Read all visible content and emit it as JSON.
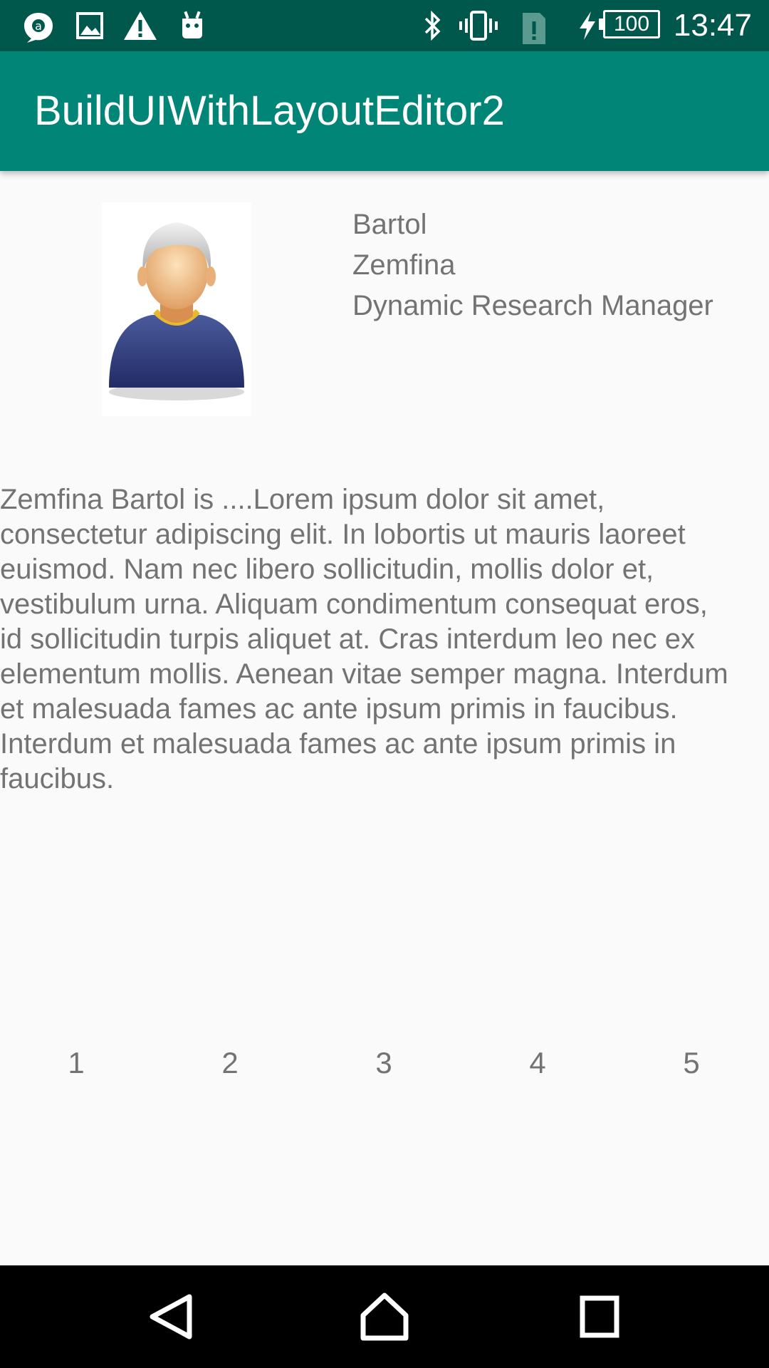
{
  "status_bar": {
    "left_icons": [
      "copilot-icon",
      "image-icon",
      "warning-icon",
      "android-icon"
    ],
    "right_icons": [
      "bluetooth-icon",
      "vibrate-icon",
      "sim-alert-icon",
      "charging-icon"
    ],
    "battery_level": "100",
    "time": "13:47"
  },
  "app_bar": {
    "title": "BuildUIWithLayoutEditor2"
  },
  "profile": {
    "last_name": "Bartol",
    "first_name": "Zemfina",
    "job_title": "Dynamic Research Manager",
    "avatar_icon": "person-avatar-icon"
  },
  "bio": {
    "text": "Zemfina Bartol is ....Lorem ipsum dolor sit amet,\nconsectetur adipiscing elit. In lobortis ut mauris laoreet\neuismod. Nam nec libero sollicitudin, mollis dolor et,\nvestibulum urna. Aliquam condimentum consequat eros,\nid sollicitudin turpis aliquet at. Cras interdum leo nec ex\nelementum mollis. Aenean vitae semper magna. Interdum\net malesuada fames ac ante ipsum primis in faucibus.\nInterdum et malesuada fames ac ante ipsum primis in\nfaucibus."
  },
  "numbers": [
    "1",
    "2",
    "3",
    "4",
    "5"
  ],
  "nav_bar": {
    "buttons": [
      "back-icon",
      "home-icon",
      "recents-icon"
    ]
  },
  "colors": {
    "status_bar": "#00574b",
    "app_bar": "#008577",
    "background": "#fafafa",
    "text_secondary": "#737373",
    "nav_bar": "#000000"
  }
}
